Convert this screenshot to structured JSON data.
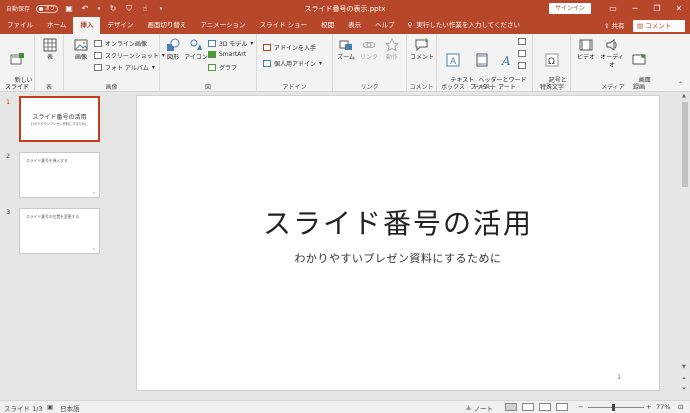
{
  "titlebar": {
    "autosave_label": "自動保存",
    "autosave_state": "オフ",
    "doc_title": "スライド番号の表示.pptx",
    "signin_label": "サインイン",
    "accent_color": "#b7472a"
  },
  "tabs": [
    {
      "label": "ファイル"
    },
    {
      "label": "ホーム"
    },
    {
      "label": "挿入"
    },
    {
      "label": "デザイン"
    },
    {
      "label": "画面切り替え"
    },
    {
      "label": "アニメーション"
    },
    {
      "label": "スライド ショー"
    },
    {
      "label": "校閲"
    },
    {
      "label": "表示"
    },
    {
      "label": "ヘルプ"
    }
  ],
  "active_tab": "挿入",
  "search": {
    "placeholder": "実行したい作業を入力してください"
  },
  "share_label": "共有",
  "comments_label": "コメント",
  "ribbon": {
    "slides_group": {
      "label": "スライド",
      "new_slide": "新しい\nスライド"
    },
    "table_group": {
      "label": "表",
      "table": "表"
    },
    "images_group": {
      "label": "画像",
      "picture": "画像",
      "online_pictures": "オンライン画像",
      "screenshot": "スクリーンショット",
      "photo_album": "フォト アルバム"
    },
    "illustrations_group": {
      "label": "図",
      "shapes": "図形",
      "icons": "アイコン",
      "model_3d": "3D モデル",
      "smartart": "SmartArt",
      "chart": "グラフ"
    },
    "addins_group": {
      "label": "アドイン",
      "get_addins": "アドインを入手",
      "my_addins": "個人用アドイン"
    },
    "links_group": {
      "label": "リンク",
      "zoom": "ズーム",
      "link": "リンク",
      "action": "動作"
    },
    "comments_group": {
      "label": "コメント",
      "comment": "コメント"
    },
    "text_group": {
      "label": "テキスト",
      "textbox": "テキスト\nボックス",
      "header_footer": "ヘッダーと\nフッター",
      "wordart": "ワード\nアート"
    },
    "symbols_group": {
      "label": "",
      "symbols": "記号と\n特殊文字"
    },
    "media_group": {
      "label": "メディア",
      "video": "ビデオ",
      "audio": "オーディオ",
      "screen_recording": "画面\n録画"
    }
  },
  "thumbnails": [
    {
      "number": "1",
      "title": "スライド番号の活用",
      "subtitle": "わかりやすいプレゼン資料にするために",
      "page": ""
    },
    {
      "number": "2",
      "title": "スライド番号を挿入する",
      "subtitle": "",
      "page": "2"
    },
    {
      "number": "3",
      "title": "スライド番号の位置を変更する",
      "subtitle": "",
      "page": "3"
    }
  ],
  "slide": {
    "title": "スライド番号の活用",
    "subtitle": "わかりやすいプレゼン資料にするために",
    "number": "1"
  },
  "status": {
    "slide_counter": "スライド 1/3",
    "language": "日本語",
    "notes_label": "ノート",
    "zoom": "77%"
  }
}
